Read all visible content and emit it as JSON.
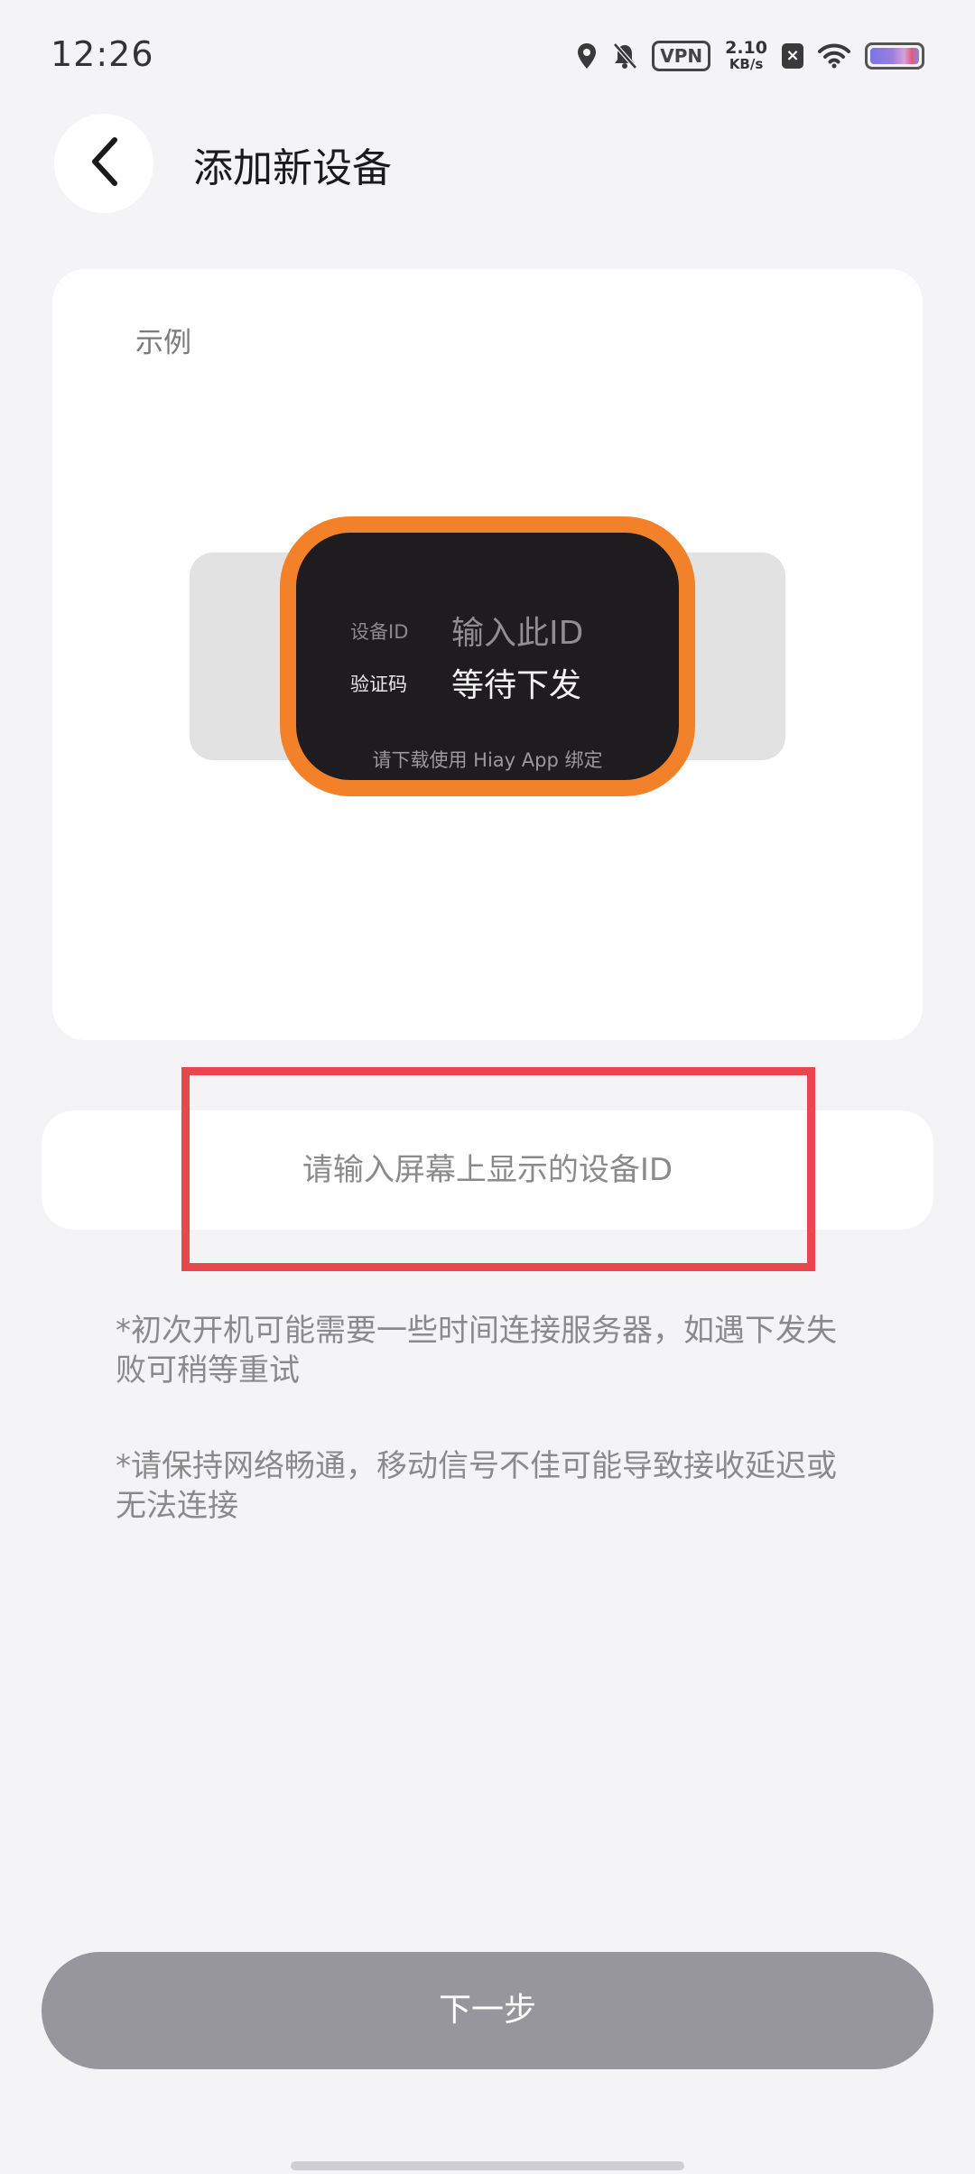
{
  "status_bar": {
    "time": "12:26",
    "vpn": "VPN",
    "net_speed_value": "2.10",
    "net_speed_unit": "KB/s",
    "icons": [
      "location-icon",
      "bell-muted-icon",
      "vpn-icon",
      "close-box-icon",
      "wifi-icon",
      "battery-icon"
    ]
  },
  "header": {
    "back_icon": "chevron-left-icon",
    "title": "添加新设备"
  },
  "example": {
    "label": "示例",
    "device_id_label": "设备ID",
    "device_id_value": "输入此ID",
    "code_label": "验证码",
    "code_value": "等待下发",
    "footer": "请下载使用 Hiay App 绑定"
  },
  "input": {
    "placeholder": "请输入屏幕上显示的设备ID",
    "value": ""
  },
  "tips": [
    {
      "text": "*初次开机可能需要一些时间连接服务器，如遇下发失败可稍等重试"
    },
    {
      "text": "*请保持网络畅通，移动信号不佳可能导致接收延迟或无法连接"
    }
  ],
  "next_button": {
    "label": "下一步"
  },
  "colors": {
    "background": "#f4f4f7",
    "watch_frame": "#f2812a",
    "highlight": "#e8484d",
    "button_disabled": "#96969c"
  }
}
